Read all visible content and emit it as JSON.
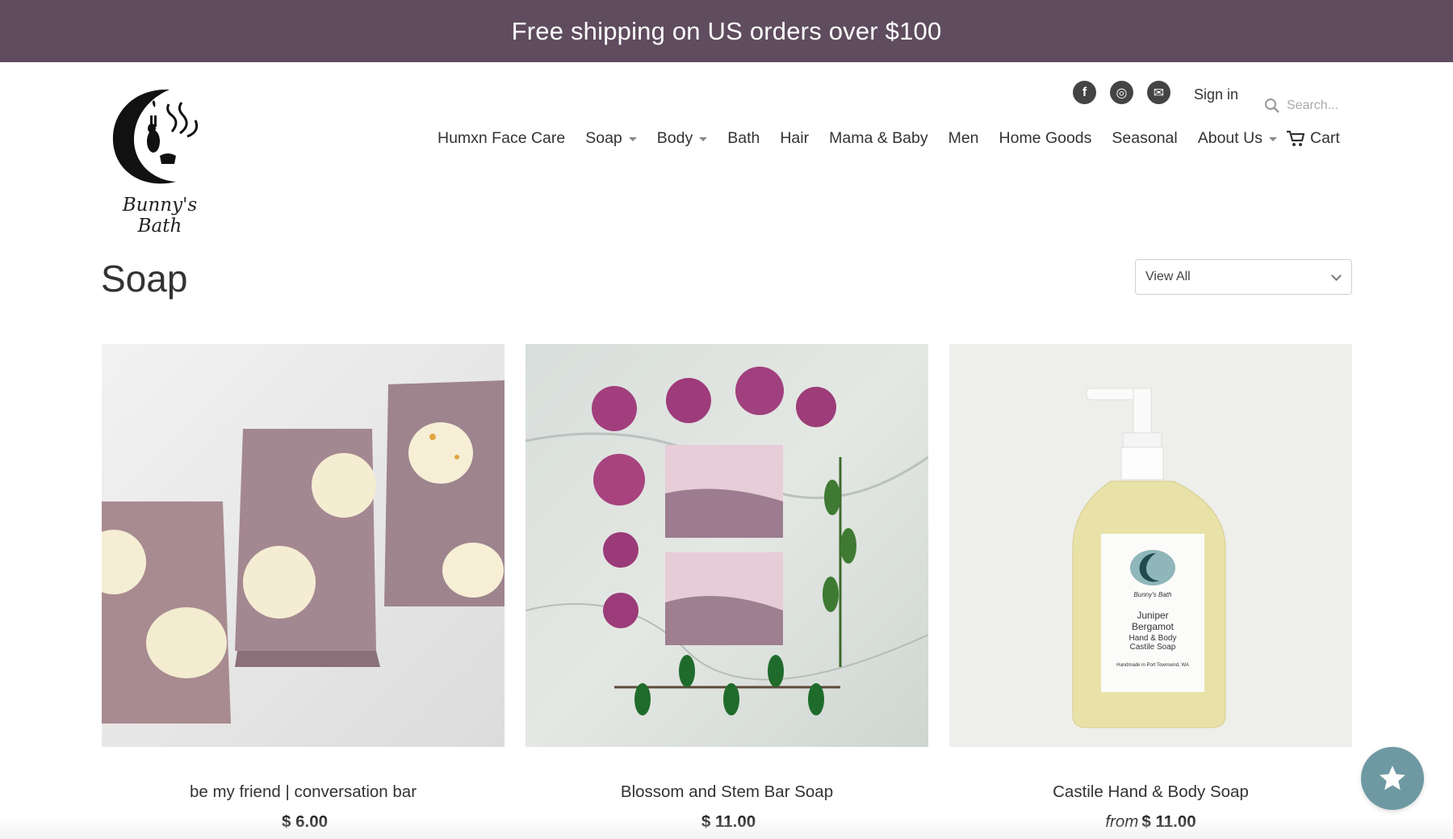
{
  "banner": {
    "text": "Free shipping on US orders over $100"
  },
  "logo": {
    "name": "Bunny's Bath"
  },
  "header": {
    "social": [
      {
        "icon": "facebook-icon",
        "glyph": "f"
      },
      {
        "icon": "instagram-icon",
        "glyph": "◎"
      },
      {
        "icon": "email-icon",
        "glyph": "✉"
      }
    ],
    "signin_label": "Sign in",
    "search_placeholder": "Search..."
  },
  "nav": {
    "items": [
      {
        "label": "Humxn Face Care",
        "dropdown": false
      },
      {
        "label": "Soap",
        "dropdown": true
      },
      {
        "label": "Body",
        "dropdown": true
      },
      {
        "label": "Bath",
        "dropdown": false
      },
      {
        "label": "Hair",
        "dropdown": false
      },
      {
        "label": "Mama & Baby",
        "dropdown": false
      },
      {
        "label": "Men",
        "dropdown": false
      },
      {
        "label": "Home Goods",
        "dropdown": false
      },
      {
        "label": "Seasonal",
        "dropdown": false
      },
      {
        "label": "About Us",
        "dropdown": true
      }
    ],
    "cart_label": "Cart"
  },
  "page": {
    "title": "Soap",
    "filter_selected": "View All"
  },
  "products": [
    {
      "title": "be my friend | conversation bar",
      "price_prefix": "",
      "price": "$ 6.00"
    },
    {
      "title": "Blossom and Stem Bar Soap",
      "price_prefix": "",
      "price": "$ 11.00"
    },
    {
      "title": "Castile Hand & Body Soap",
      "price_prefix": "from",
      "price": "$ 11.00"
    }
  ],
  "bottle_label": {
    "brand": "Bunny's Bath",
    "line1": "Juniper",
    "line2": "Bergamot",
    "line3": "Hand & Body",
    "line4": "Castile Soap",
    "line5": "Handmade in Port Townsend, WA"
  },
  "colors": {
    "banner_bg": "#5f4c5e",
    "reviews_button": "#6e99a3"
  }
}
